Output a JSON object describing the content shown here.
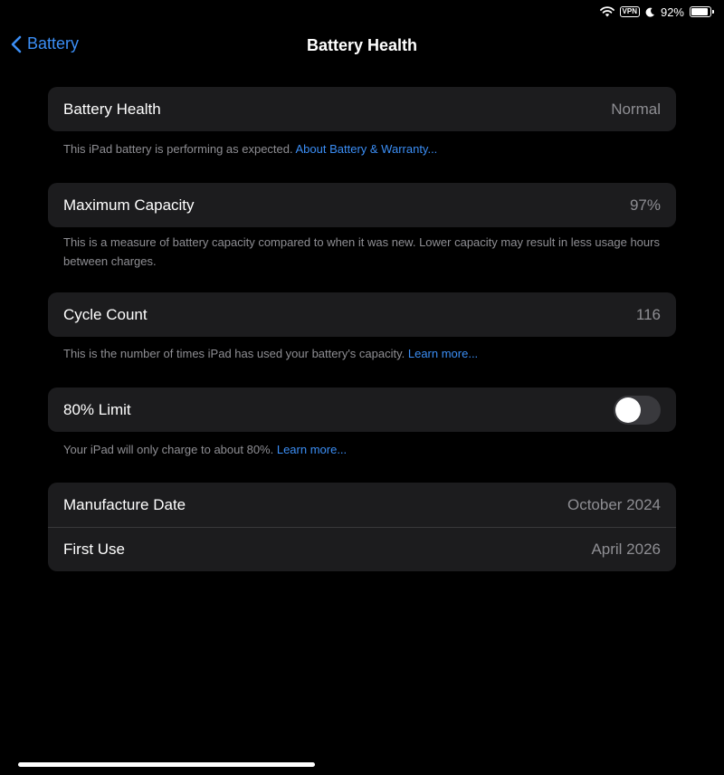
{
  "status_bar": {
    "vpn": "VPN",
    "battery_percent": "92%",
    "battery_level": 0.92
  },
  "nav": {
    "back_label": "Battery",
    "title": "Battery Health"
  },
  "battery_health": {
    "label": "Battery Health",
    "value": "Normal",
    "footer_text": "This iPad battery is performing as expected. ",
    "footer_link": "About Battery & Warranty..."
  },
  "max_capacity": {
    "label": "Maximum Capacity",
    "value": "97%",
    "footer_text": "This is a measure of battery capacity compared to when it was new. Lower capacity may result in less usage hours between charges."
  },
  "cycle_count": {
    "label": "Cycle Count",
    "value": "116",
    "footer_text": "This is the number of times iPad has used your battery's capacity. ",
    "footer_link": "Learn more..."
  },
  "limit": {
    "label": "80% Limit",
    "enabled": false,
    "footer_text": "Your iPad will only charge to about 80%. ",
    "footer_link": "Learn more..."
  },
  "dates": {
    "manufacture_label": "Manufacture Date",
    "manufacture_value": "October 2024",
    "first_use_label": "First Use",
    "first_use_value": "April 2026"
  },
  "colors": {
    "accent": "#3b8ef5",
    "cell_bg": "#1c1c1e",
    "background": "#000000",
    "secondary_text": "#8e8e93"
  }
}
